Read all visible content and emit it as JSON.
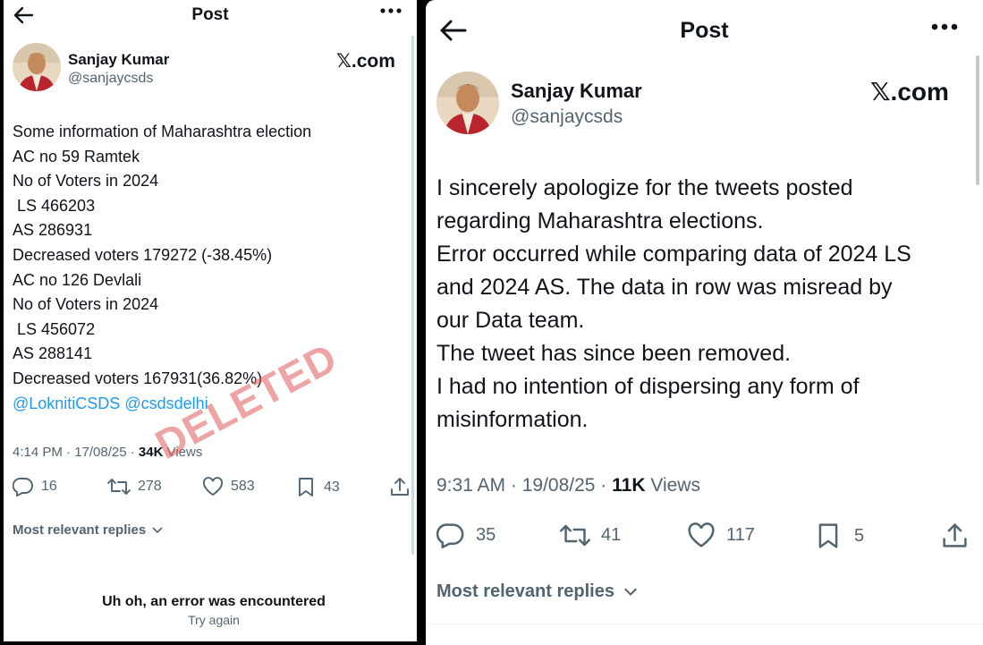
{
  "left": {
    "header": {
      "title": "Post"
    },
    "author": {
      "name": "Sanjay Kumar",
      "handle": "@sanjaycsds"
    },
    "brand": "𝕏.com",
    "body": [
      "Some information of Maharashtra election",
      "AC no 59 Ramtek",
      "No of Voters in 2024",
      " LS 466203",
      "AS 286931",
      "Decreased voters 179272 (-38.45%)",
      "AC no 126 Devlali",
      "No of Voters in 2024",
      " LS 456072",
      "AS 288141",
      "Decreased voters 167931(36.82%)"
    ],
    "mentions": "@LoknitiCSDS @csdsdelhi",
    "meta": {
      "time": "4:14 PM · 17/08/25 · ",
      "views_count": "34K",
      "views_label": " Views"
    },
    "stamp": "DELETED",
    "actions": {
      "replies": "16",
      "reposts": "278",
      "likes": "583",
      "bookmarks": "43"
    },
    "relevant_label": "Most relevant replies",
    "error": {
      "title": "Uh oh, an error was encountered",
      "retry": "Try again"
    }
  },
  "right": {
    "header": {
      "title": "Post"
    },
    "author": {
      "name": "Sanjay Kumar",
      "handle": "@sanjaycsds"
    },
    "brand": "𝕏.com",
    "body": [
      "I sincerely apologize for the tweets posted",
      "regarding Maharashtra elections.",
      "Error occurred while comparing data of 2024 LS",
      "and 2024 AS. The data in row was misread by",
      "our Data team.",
      "The tweet has since been removed.",
      "I had no intention of dispersing any form of",
      "misinformation."
    ],
    "meta": {
      "time": "9:31 AM · 19/08/25 · ",
      "views_count": "11K",
      "views_label": " Views"
    },
    "actions": {
      "replies": "35",
      "reposts": "41",
      "likes": "117",
      "bookmarks": "5"
    },
    "relevant_label": "Most relevant replies"
  },
  "icons": [
    "back-arrow-icon",
    "more-options-icon",
    "reply-icon",
    "repost-icon",
    "like-icon",
    "bookmark-icon",
    "share-icon",
    "chevron-down-icon"
  ],
  "colors": {
    "mention": "#1d9bf0",
    "stamp": "#e05a5a",
    "secondary_text": "#536471"
  }
}
